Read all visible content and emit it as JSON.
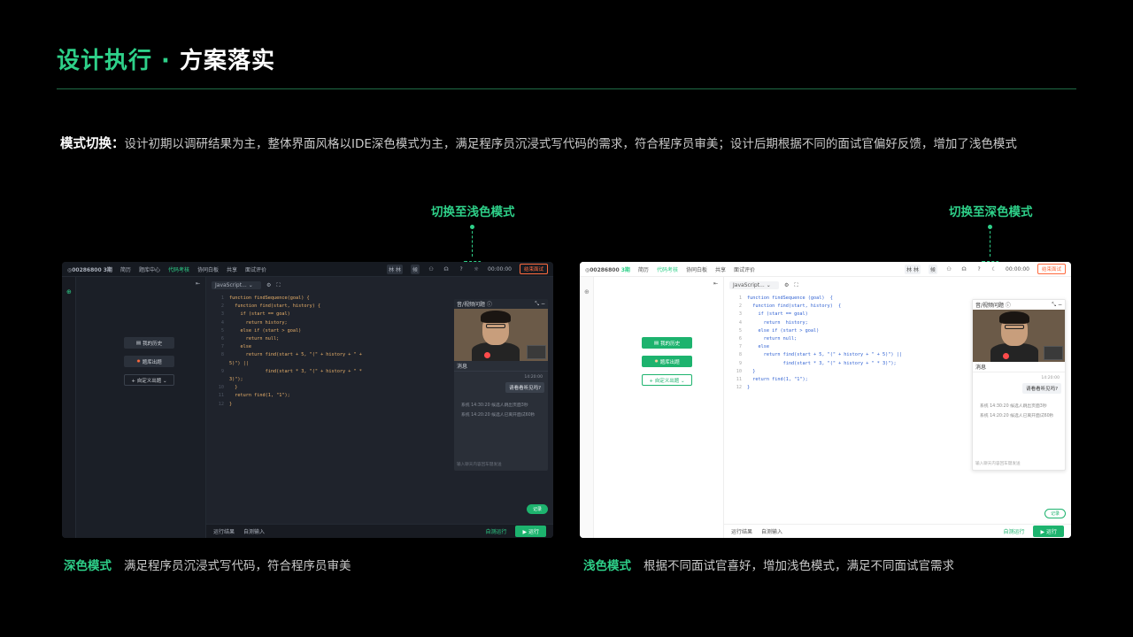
{
  "slide": {
    "title_accent": "设计执行 · ",
    "title_main": "方案落实",
    "intro_label": "模式切换：",
    "intro_text": "设计初期以调研结果为主，整体界面风格以IDE深色模式为主，满足程序员沉浸式写代码的需求，符合程序员审美；设计后期根据不同的面试官偏好反馈，增加了浅色模式"
  },
  "callouts": {
    "dark_to_light": "切换至浅色模式",
    "light_to_dark": "切换至深色模式"
  },
  "captions": {
    "dark_tag": "深色模式",
    "dark_desc": "满足程序员沉浸式写代码，符合程序员审美",
    "light_tag": "浅色模式",
    "light_desc": "根据不同面试官喜好，增加浅色模式，满足不同面试官需求"
  },
  "app": {
    "logo": "◎00286800",
    "logo_badge": "3期",
    "nav": [
      "简历",
      "题库中心",
      "代码考核",
      "协同白板",
      "共享",
      "面试评价"
    ],
    "nav_light": [
      "简历",
      "代码考核",
      "协同白板",
      "共享",
      "面试评价"
    ],
    "avatar_a": "林 林",
    "avatar_b": "候",
    "timer": "00:00:00",
    "end_button": "结束面试",
    "side_history": "我的历史",
    "side_bank": "题库出题",
    "side_custom": "+ 自定义出题 ⌄",
    "language": "JavaScript... ⌄",
    "panel_title": "音/视频问题 ⓘ",
    "messages_title": "消息",
    "msg_time": "14:20:00",
    "msg_bubble": "请看看听见吗?",
    "sys_msg_1": "系统 14:30:20  候选人跳出页面3秒",
    "sys_msg_2": "系统 14:20:20  候选人已离开面试60秒",
    "input_hint": "输入聊天内容回车键发送",
    "record_button": "记录",
    "run_result": "运行结果",
    "custom_input": "自测输入",
    "self_test": "自测运行",
    "run_button": "▶ 运行"
  },
  "code_dark": [
    {
      "n": "1",
      "t": "function findSequence(goal) {"
    },
    {
      "n": "2",
      "t": "  function find(start, history) {"
    },
    {
      "n": "3",
      "t": "    if (start == goal)"
    },
    {
      "n": "4",
      "t": "      return history;"
    },
    {
      "n": "5",
      "t": "    else if (start > goal)"
    },
    {
      "n": "6",
      "t": "      return null;"
    },
    {
      "n": "7",
      "t": "    else"
    },
    {
      "n": "8",
      "t": "      return find(start + 5, \"(\" + history + \" +"
    },
    {
      "n": "",
      "t": "5)\") ||"
    },
    {
      "n": "9",
      "t": "             find(start * 3, \"(\" + history + \" *"
    },
    {
      "n": "",
      "t": "3)\");"
    },
    {
      "n": "10",
      "t": "  }"
    },
    {
      "n": "11",
      "t": "  return find(1, \"1\");"
    },
    {
      "n": "12",
      "t": "}"
    }
  ],
  "code_light": [
    {
      "n": "1",
      "t": "function findSequence (goal)  {"
    },
    {
      "n": "2",
      "t": "  function find(start, history)  {"
    },
    {
      "n": "3",
      "t": "    if (start == goal)"
    },
    {
      "n": "4",
      "t": "      return  history;"
    },
    {
      "n": "5",
      "t": "    else if (start > goal)"
    },
    {
      "n": "6",
      "t": "      return null;"
    },
    {
      "n": "7",
      "t": "    else"
    },
    {
      "n": "8",
      "t": "      return find(start + 5, \"(\" + history + \" + 5)\") ||"
    },
    {
      "n": "9",
      "t": "             find(start * 3, \"(\" + history + \" * 3)\");"
    },
    {
      "n": "10",
      "t": "  }"
    },
    {
      "n": "11",
      "t": "  return find(1, \"1\");"
    },
    {
      "n": "12",
      "t": "}"
    }
  ],
  "colors": {
    "accent": "#2ed089",
    "alert": "#ff6a3d"
  }
}
